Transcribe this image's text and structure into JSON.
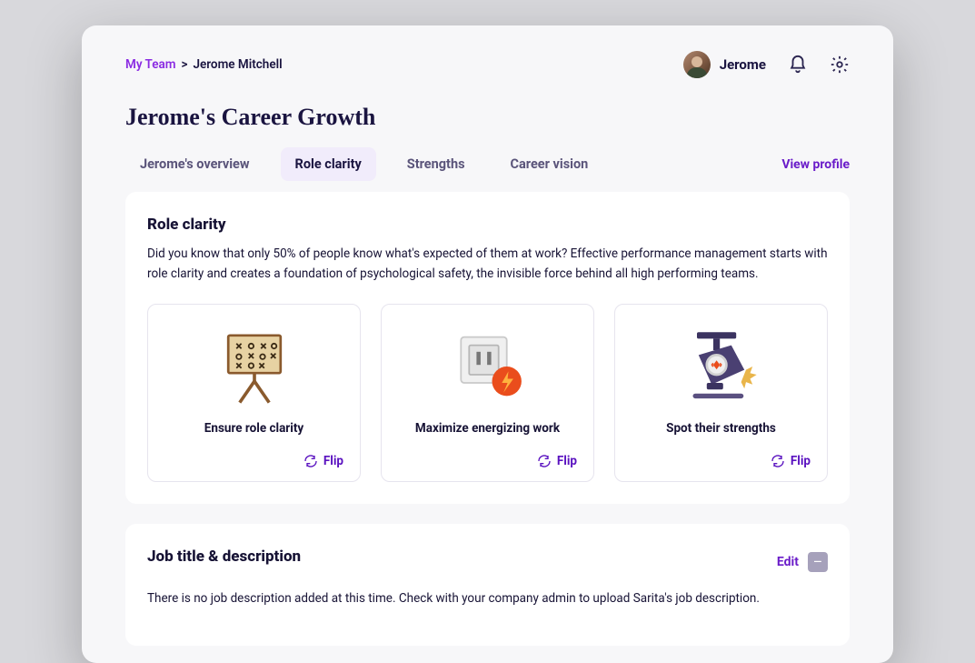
{
  "breadcrumb": {
    "root": "My Team",
    "sep": ">",
    "current": "Jerome Mitchell"
  },
  "header": {
    "user_name": "Jerome"
  },
  "page_title": "Jerome's Career Growth",
  "tabs": [
    {
      "label": "Jerome's overview",
      "active": false
    },
    {
      "label": "Role clarity",
      "active": true
    },
    {
      "label": "Strengths",
      "active": false
    },
    {
      "label": "Career vision",
      "active": false
    }
  ],
  "view_profile_label": "View profile",
  "role_clarity_panel": {
    "title": "Role clarity",
    "description": "Did you know that only 50% of people know what's expected of them at work? Effective performance management starts with role clarity and creates a foundation of psychological safety, the invisible force behind all high performing teams.",
    "cards": [
      {
        "title": "Ensure role clarity",
        "flip": "Flip"
      },
      {
        "title": "Maximize energizing work",
        "flip": "Flip"
      },
      {
        "title": "Spot their strengths",
        "flip": "Flip"
      }
    ]
  },
  "job_panel": {
    "title": "Job title & description",
    "edit": "Edit",
    "description": "There is no job description added at this time. Check with your company admin to upload Sarita's job description."
  }
}
